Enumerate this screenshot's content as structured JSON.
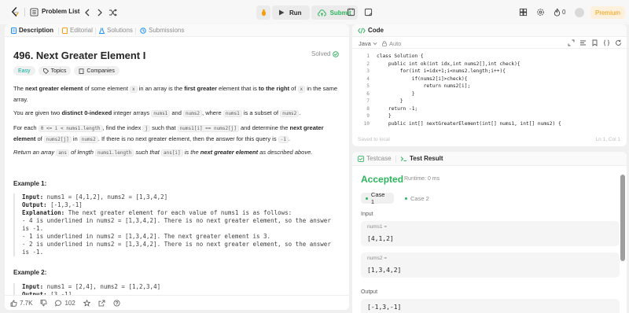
{
  "topbar": {
    "problem_list_label": "Problem List",
    "run_label": "Run",
    "submit_label": "Submit",
    "fire_count": "0",
    "premium_label": "Premium"
  },
  "left_tabs": {
    "description": "Description",
    "editorial": "Editorial",
    "solutions": "Solutions",
    "submissions": "Submissions"
  },
  "problem": {
    "title": "496. Next Greater Element I",
    "status": "Solved",
    "tags": [
      "Easy",
      "Topics",
      "Companies"
    ],
    "p1": {
      "a": "The ",
      "b": "next greater element",
      "c": " of some element ",
      "d": "x",
      "e": " in an array is the ",
      "f": "first greater",
      "g": " element that is ",
      "h": "to the right",
      "i": " of ",
      "j": "x",
      "k": " in the same array."
    },
    "p2": {
      "a": "You are given two ",
      "b": "distinct 0-indexed",
      "c": " integer arrays ",
      "d": "nums1",
      "e": " and ",
      "f": "nums2",
      "g": ", where ",
      "h": "nums1",
      "i": " is a subset of ",
      "j": "nums2",
      "k": "."
    },
    "p3": {
      "a": "For each ",
      "b": "0 <= i < nums1.length",
      "c": ", find the index ",
      "d": "j",
      "e": " such that ",
      "f": "nums1[i] == nums2[j]",
      "g": " and determine the ",
      "h": "next greater element",
      "i": " of ",
      "j": "nums2[j]",
      "k": " in ",
      "l": "nums2",
      "m": ". If there is no next greater element, then the answer for this query is ",
      "n": "-1",
      "o": "."
    },
    "p4": {
      "a": "Return an array ",
      "b": "ans",
      "c": " of length ",
      "d": "nums1.length",
      "e": " such that ",
      "f": "ans[i]",
      "g": " is the ",
      "h": "next greater element",
      "i": " as described above."
    },
    "example1": {
      "title": "Example 1:",
      "input_label": "Input:",
      "input": " nums1 = [4,1,2], nums2 = [1,3,4,2]",
      "output_label": "Output:",
      "output": " [-1,3,-1]",
      "explanation_label": "Explanation:",
      "explanation": " The next greater element for each value of nums1 is as follows:",
      "lines": [
        "- 4 is underlined in nums2 = [1,3,4,2]. There is no next greater element, so the answer",
        "is -1.",
        "- 1 is underlined in nums2 = [1,3,4,2]. The next greater element is 3.",
        "- 2 is underlined in nums2 = [1,3,4,2]. There is no next greater element, so the answer",
        "is -1."
      ]
    },
    "example2": {
      "title": "Example 2:",
      "input_label": "Input:",
      "input": " nums1 = [2,4], nums2 = [1,2,3,4]",
      "output_label": "Output:",
      "output": " [3,-1]"
    }
  },
  "left_footer": {
    "likes": "7.7K",
    "comments": "102"
  },
  "code_panel": {
    "title": "Code",
    "language": "Java",
    "mode": "Auto",
    "saved_text": "Saved to local",
    "cursor_pos": "Ln 1, Col 1",
    "line_numbers": [
      "1",
      "2",
      "3",
      "4",
      "5",
      "6",
      "7",
      "8",
      "9",
      "10"
    ],
    "lines": [
      "class Solution {",
      "    public int ok(int idx,int nums2[],int check){",
      "        for(int i=idx+1;i<nums2.length;i++){",
      "            if(nums2[i]>check){",
      "                return nums2[i];",
      "            }",
      "        }",
      "    return -1;",
      "    }",
      "    public int[] nextGreaterElement(int[] nums1, int[] nums2) {"
    ]
  },
  "result_panel": {
    "testcase_tab": "Testcase",
    "result_tab": "Test Result",
    "status": "Accepted",
    "runtime": "Runtime: 0 ms",
    "cases": [
      "Case 1",
      "Case 2"
    ],
    "input_label": "Input",
    "inputs": [
      {
        "name": "nums1 =",
        "value": "[4,1,2]"
      },
      {
        "name": "nums2 =",
        "value": "[1,3,4,2]"
      }
    ],
    "output_label": "Output",
    "output_value": "[-1,3,-1]"
  },
  "colors": {
    "accent_green": "#2db55d",
    "easy_teal": "#00af9b",
    "premium_orange": "#f59e0b"
  }
}
